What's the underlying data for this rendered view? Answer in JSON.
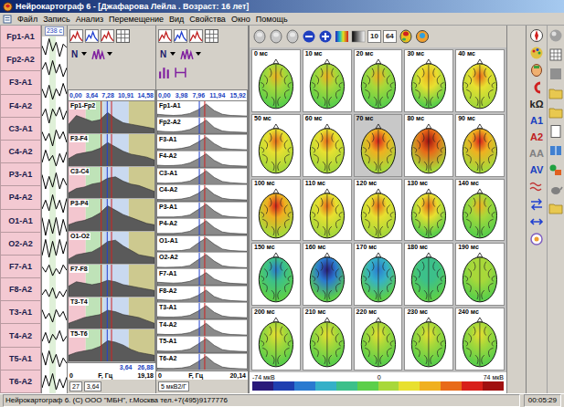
{
  "window": {
    "title": "Нейрокартограф 6 - [Джафарова Лейла . Возраст: 16 лет]"
  },
  "menu": [
    "Файл",
    "Запись",
    "Анализ",
    "Перемещение",
    "Вид",
    "Свойства",
    "Окно",
    "Помощь"
  ],
  "trace_panel": {
    "time": "238 с"
  },
  "channels": [
    {
      "name": "Fp1-A1",
      "wave": [
        0.1,
        -0.4,
        0.5,
        -0.2,
        0.3,
        -0.5,
        0.2,
        0.0
      ]
    },
    {
      "name": "Fp2-A2",
      "wave": [
        0.0,
        0.4,
        -0.3,
        0.5,
        -0.2,
        0.3,
        -0.4,
        0.1
      ]
    },
    {
      "name": "F3-A1",
      "wave": [
        0.2,
        -0.3,
        0.4,
        -0.4,
        0.2,
        -0.2,
        0.5,
        -0.1
      ]
    },
    {
      "name": "F4-A2",
      "wave": [
        -0.1,
        0.3,
        -0.5,
        0.3,
        -0.1,
        0.4,
        -0.3,
        0.2
      ]
    },
    {
      "name": "C3-A1",
      "wave": [
        0.3,
        -0.2,
        0.2,
        -0.5,
        0.4,
        -0.1,
        0.3,
        -0.3
      ]
    },
    {
      "name": "C4-A2",
      "wave": [
        -0.2,
        0.5,
        -0.1,
        0.2,
        -0.4,
        0.3,
        -0.2,
        0.4
      ]
    },
    {
      "name": "P3-A1",
      "wave": [
        0.4,
        -0.4,
        0.3,
        -0.3,
        0.5,
        -0.4,
        0.2,
        -0.2
      ]
    },
    {
      "name": "P4-A2",
      "wave": [
        -0.3,
        0.2,
        -0.4,
        0.5,
        -0.3,
        0.2,
        -0.5,
        0.3
      ]
    },
    {
      "name": "O1-A1",
      "wave": [
        0.5,
        -0.5,
        0.4,
        -0.4,
        0.5,
        -0.5,
        0.4,
        -0.3
      ]
    },
    {
      "name": "O2-A2",
      "wave": [
        -0.4,
        0.5,
        -0.5,
        0.4,
        -0.4,
        0.5,
        -0.3,
        0.4
      ]
    },
    {
      "name": "F7-A1",
      "wave": [
        0.2,
        -0.1,
        0.3,
        -0.3,
        0.1,
        -0.2,
        0.3,
        0.0
      ]
    },
    {
      "name": "F8-A2",
      "wave": [
        -0.1,
        0.2,
        -0.2,
        0.3,
        -0.3,
        0.1,
        -0.2,
        0.2
      ]
    },
    {
      "name": "T3-A1",
      "wave": [
        0.3,
        -0.2,
        0.1,
        -0.4,
        0.3,
        -0.1,
        0.2,
        -0.3
      ]
    },
    {
      "name": "T4-A2",
      "wave": [
        -0.2,
        0.3,
        -0.3,
        0.2,
        -0.1,
        0.4,
        -0.2,
        0.1
      ]
    },
    {
      "name": "T5-A1",
      "wave": [
        0.4,
        -0.3,
        0.5,
        -0.2,
        0.3,
        -0.4,
        0.1,
        -0.2
      ]
    },
    {
      "name": "T6-A2",
      "wave": [
        -0.3,
        0.4,
        -0.2,
        0.5,
        -0.4,
        0.2,
        -0.3,
        0.3
      ]
    }
  ],
  "spectra": [
    {
      "kind": "compare",
      "toolbar_text": "N",
      "ticks": [
        "0,00",
        "3,64",
        "7,28",
        "10,91",
        "14,58"
      ],
      "bands": [
        {
          "color": "#f3c6cf",
          "level": 0.2
        },
        {
          "color": "#bfe3b8",
          "level": 0.2
        },
        {
          "color": "#c9d9f0",
          "level": 0.3
        },
        {
          "color": "#cdc98f",
          "level": 0.3
        }
      ],
      "markers": [
        {
          "color": "#d02020",
          "at": 0.38
        },
        {
          "color": "#2040d0",
          "at": 0.45
        },
        {
          "color": "#d02020",
          "at": 0.5
        }
      ],
      "rows": [
        {
          "label": "Fp1-Fp2",
          "values": [
            0.3,
            0.6,
            0.5,
            0.4,
            0.45,
            0.7,
            0.5,
            0.35,
            0.3,
            0.25,
            0.2,
            0.15
          ]
        },
        {
          "label": "F3-F4",
          "values": [
            0.25,
            0.4,
            0.45,
            0.5,
            0.6,
            0.8,
            0.65,
            0.5,
            0.4,
            0.35,
            0.3,
            0.2
          ]
        },
        {
          "label": "C3-C4",
          "values": [
            0.2,
            0.35,
            0.4,
            0.5,
            0.55,
            0.7,
            0.75,
            0.6,
            0.5,
            0.45,
            0.35,
            0.25
          ]
        },
        {
          "label": "P3-P4",
          "values": [
            0.2,
            0.3,
            0.35,
            0.45,
            0.6,
            0.85,
            0.7,
            0.55,
            0.45,
            0.35,
            0.25,
            0.2
          ]
        },
        {
          "label": "O1-O2",
          "values": [
            0.15,
            0.3,
            0.35,
            0.4,
            0.55,
            0.75,
            0.8,
            0.6,
            0.45,
            0.3,
            0.25,
            0.2
          ]
        },
        {
          "label": "F7-F8",
          "values": [
            0.35,
            0.5,
            0.45,
            0.4,
            0.45,
            0.55,
            0.5,
            0.4,
            0.35,
            0.3,
            0.25,
            0.2
          ]
        },
        {
          "label": "T3-T4",
          "values": [
            0.2,
            0.3,
            0.4,
            0.45,
            0.5,
            0.65,
            0.6,
            0.5,
            0.45,
            0.4,
            0.3,
            0.2
          ]
        },
        {
          "label": "T5-T6",
          "values": [
            0.2,
            0.3,
            0.35,
            0.4,
            0.5,
            0.7,
            0.65,
            0.55,
            0.4,
            0.3,
            0.25,
            0.2
          ]
        }
      ],
      "readout": [
        "3,64",
        "26,88"
      ],
      "axis": [
        "0",
        "F, Гц",
        "19,18"
      ],
      "footer": [
        "27",
        "3,64"
      ]
    },
    {
      "kind": "mono",
      "toolbar_text": "N",
      "ticks": [
        "0,00",
        "3,98",
        "7,96",
        "11,94",
        "15,92"
      ],
      "bands": [],
      "markers": [
        {
          "color": "#2040d0",
          "at": 0.47
        },
        {
          "color": "#d02020",
          "at": 0.53
        }
      ],
      "rows": [
        {
          "label": "Fp1-A1",
          "values": [
            0.2,
            0.15,
            0.12,
            0.15,
            0.25,
            0.5,
            0.9,
            0.45,
            0.2,
            0.12,
            0.1,
            0.08
          ]
        },
        {
          "label": "Fp2-A2",
          "values": [
            0.18,
            0.14,
            0.12,
            0.16,
            0.28,
            0.55,
            0.92,
            0.42,
            0.18,
            0.12,
            0.1,
            0.08
          ]
        },
        {
          "label": "F3-A1",
          "values": [
            0.15,
            0.12,
            0.12,
            0.18,
            0.3,
            0.6,
            0.95,
            0.5,
            0.2,
            0.12,
            0.1,
            0.08
          ]
        },
        {
          "label": "F4-A2",
          "values": [
            0.15,
            0.12,
            0.13,
            0.17,
            0.3,
            0.58,
            0.93,
            0.48,
            0.2,
            0.12,
            0.1,
            0.08
          ]
        },
        {
          "label": "C3-A1",
          "values": [
            0.12,
            0.1,
            0.12,
            0.15,
            0.25,
            0.55,
            0.95,
            0.5,
            0.22,
            0.14,
            0.1,
            0.08
          ]
        },
        {
          "label": "C4-A2",
          "values": [
            0.12,
            0.1,
            0.11,
            0.15,
            0.26,
            0.52,
            0.92,
            0.46,
            0.2,
            0.12,
            0.1,
            0.08
          ]
        },
        {
          "label": "P3-A1",
          "values": [
            0.1,
            0.1,
            0.1,
            0.14,
            0.24,
            0.6,
            0.98,
            0.52,
            0.2,
            0.12,
            0.09,
            0.07
          ]
        },
        {
          "label": "P4-A2",
          "values": [
            0.1,
            0.1,
            0.1,
            0.14,
            0.25,
            0.58,
            0.96,
            0.5,
            0.2,
            0.12,
            0.09,
            0.07
          ]
        },
        {
          "label": "O1-A1",
          "values": [
            0.1,
            0.09,
            0.1,
            0.12,
            0.22,
            0.62,
            0.98,
            0.55,
            0.22,
            0.12,
            0.09,
            0.07
          ]
        },
        {
          "label": "O2-A2",
          "values": [
            0.1,
            0.09,
            0.1,
            0.12,
            0.22,
            0.6,
            0.97,
            0.52,
            0.2,
            0.12,
            0.09,
            0.07
          ]
        },
        {
          "label": "F7-A1",
          "values": [
            0.2,
            0.16,
            0.14,
            0.16,
            0.26,
            0.5,
            0.85,
            0.42,
            0.2,
            0.13,
            0.1,
            0.08
          ]
        },
        {
          "label": "F8-A2",
          "values": [
            0.2,
            0.16,
            0.14,
            0.16,
            0.25,
            0.48,
            0.84,
            0.4,
            0.2,
            0.13,
            0.1,
            0.08
          ]
        },
        {
          "label": "T3-A1",
          "values": [
            0.15,
            0.12,
            0.12,
            0.15,
            0.24,
            0.52,
            0.9,
            0.45,
            0.2,
            0.12,
            0.1,
            0.08
          ]
        },
        {
          "label": "T4-A2",
          "values": [
            0.15,
            0.12,
            0.12,
            0.15,
            0.24,
            0.5,
            0.88,
            0.44,
            0.2,
            0.12,
            0.1,
            0.08
          ]
        },
        {
          "label": "T5-A1",
          "values": [
            0.12,
            0.1,
            0.1,
            0.14,
            0.24,
            0.58,
            0.95,
            0.5,
            0.2,
            0.12,
            0.09,
            0.07
          ]
        },
        {
          "label": "T6-A2",
          "values": [
            0.12,
            0.1,
            0.1,
            0.14,
            0.24,
            0.56,
            0.94,
            0.48,
            0.2,
            0.12,
            0.09,
            0.07
          ]
        }
      ],
      "readout": [],
      "axis": [
        "0",
        "F, Гц",
        "20,14"
      ],
      "footer": [
        "5 мкВ2/Г"
      ]
    }
  ],
  "map_panel": {
    "toolbar_texts": [
      "10",
      "64"
    ],
    "maps": [
      {
        "label": "0 мс",
        "level": 0.45,
        "peak": 0.7,
        "selected": false
      },
      {
        "label": "10 мс",
        "level": 0.45,
        "peak": 0.72,
        "selected": false
      },
      {
        "label": "20 мс",
        "level": 0.45,
        "peak": 0.7,
        "selected": false
      },
      {
        "label": "30 мс",
        "level": 0.45,
        "peak": 0.75,
        "selected": false
      },
      {
        "label": "40 мс",
        "level": 0.5,
        "peak": 0.78,
        "selected": false
      },
      {
        "label": "50 мс",
        "level": 0.5,
        "peak": 0.8,
        "selected": false
      },
      {
        "label": "60 мс",
        "level": 0.5,
        "peak": 0.85,
        "selected": false
      },
      {
        "label": "70 мс",
        "level": 0.55,
        "peak": 0.95,
        "selected": true
      },
      {
        "label": "80 мс",
        "level": 0.55,
        "peak": 1.0,
        "selected": false
      },
      {
        "label": "90 мс",
        "level": 0.55,
        "peak": 0.95,
        "selected": false
      },
      {
        "label": "100 мс",
        "level": 0.5,
        "peak": 0.88,
        "selected": false
      },
      {
        "label": "110 мс",
        "level": 0.5,
        "peak": 0.85,
        "selected": false
      },
      {
        "label": "120 мс",
        "level": 0.5,
        "peak": 0.82,
        "selected": false
      },
      {
        "label": "130 мс",
        "level": 0.48,
        "peak": 0.78,
        "selected": false
      },
      {
        "label": "140 мс",
        "level": 0.45,
        "peak": 0.72,
        "selected": false
      },
      {
        "label": "150 мс",
        "level": 0.45,
        "peak": 0.2,
        "selected": false
      },
      {
        "label": "160 мс",
        "level": 0.45,
        "peak": 0.0,
        "selected": false
      },
      {
        "label": "170 мс",
        "level": 0.45,
        "peak": 0.18,
        "selected": false
      },
      {
        "label": "180 мс",
        "level": 0.45,
        "peak": 0.35,
        "selected": false
      },
      {
        "label": "190 мс",
        "level": 0.45,
        "peak": 0.55,
        "selected": false
      },
      {
        "label": "200 мс",
        "level": 0.45,
        "peak": 0.65,
        "selected": false
      },
      {
        "label": "210 мс",
        "level": 0.45,
        "peak": 0.68,
        "selected": false
      },
      {
        "label": "220 мс",
        "level": 0.45,
        "peak": 0.65,
        "selected": false
      },
      {
        "label": "230 мс",
        "level": 0.45,
        "peak": 0.68,
        "selected": false
      },
      {
        "label": "240 мс",
        "level": 0.45,
        "peak": 0.65,
        "selected": false
      }
    ],
    "scale": {
      "labels": [
        "-74 мкВ",
        "0",
        "74 мкВ"
      ],
      "colors": [
        "#2a1a7a",
        "#1f3fb0",
        "#2a7ad0",
        "#35b0c8",
        "#3cc08a",
        "#5ccf4a",
        "#a8d83a",
        "#e8e030",
        "#f0b020",
        "#e86a18",
        "#d8201a",
        "#a01010"
      ]
    }
  },
  "right_toolbar": {
    "labels": [
      {
        "text": "kΩ",
        "color": "#202020"
      },
      {
        "text": "A1",
        "color": "#1a3fc0"
      },
      {
        "text": "A2",
        "color": "#c02020"
      },
      {
        "text": "AA",
        "color": "#808080"
      },
      {
        "text": "AV",
        "color": "#1a3fc0"
      }
    ]
  },
  "status_bar": {
    "text": "Нейрокартограф 6. (С) ООО \"МБН\", г.Москва тел.+7(495)9177776",
    "time": "00:05:29"
  }
}
